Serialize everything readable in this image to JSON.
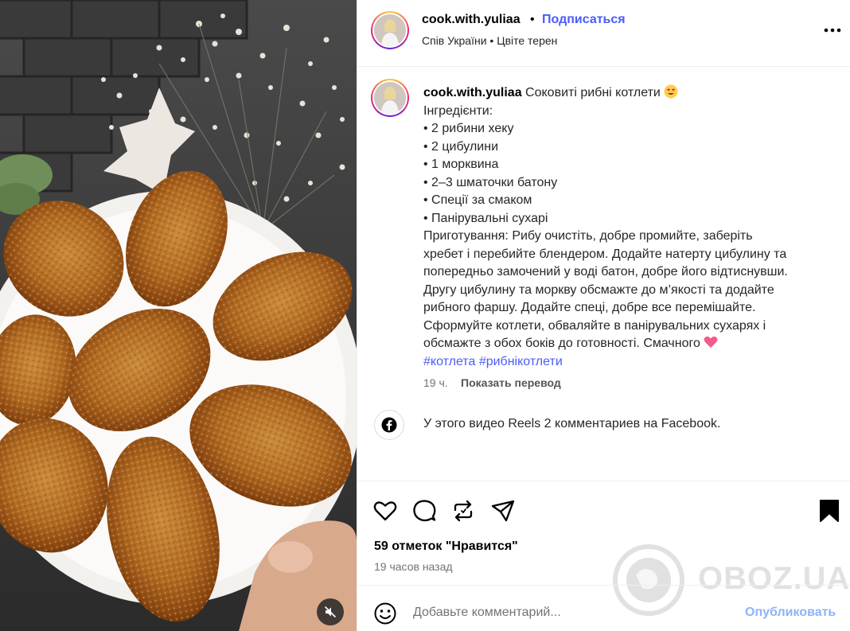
{
  "post": {
    "username": "cook.with.yuliaa",
    "separator_dot": "•",
    "follow_label": "Подписаться",
    "audio": "Спів України • Цвіте терен"
  },
  "caption": {
    "username": "cook.with.yuliaa",
    "title": "Соковиті рибні котлети",
    "ingredients_heading": "Інгредієнти:",
    "ingredients": [
      "• 2 рибини хеку",
      "• 2 цибулини",
      "• 1 морквина",
      "• 2–3 шматочки батону",
      "• Спеції за смаком",
      "• Панірувальні сухарі"
    ],
    "method_lines": [
      "Приготування: Рибу очистіть, добре промийте, заберіть",
      "хребет і перебийте блендером. Додайте натерту цибулину та",
      "попередньо замочений у воді батон, добре його відтиснувши.",
      "Другу цибулину та моркву обсмажте до м’якості та додайте",
      "рибного фаршу. Додайте спеці, добре все перемішайте.",
      "Сформуйте котлети, обваляйте в панірувальних сухарях і",
      "обсмажте з обох боків до готовності. Смачного"
    ],
    "hashtags": [
      "#котлета",
      "#рибнікотлети"
    ],
    "age": "19 ч.",
    "translate_label": "Показать перевод"
  },
  "facebook": {
    "icon": "facebook-icon",
    "text": "У этого видео Reels 2 комментариев на Facebook."
  },
  "actions": {
    "icons": [
      "heart-icon",
      "comment-icon",
      "repost-icon",
      "share-icon",
      "bookmark-icon"
    ],
    "likes_text": "59 отметок \"Нравится\"",
    "time_ago": "19 часов назад"
  },
  "comment": {
    "placeholder": "Добавьте комментарий...",
    "publish_label": "Опубликовать"
  },
  "watermark": {
    "text": "OBOZ.UA"
  },
  "colors": {
    "link_blue": "#4a5df9",
    "publish_disabled": "#8eb3f7",
    "muted_text": "#737373",
    "divider": "#efefef"
  }
}
